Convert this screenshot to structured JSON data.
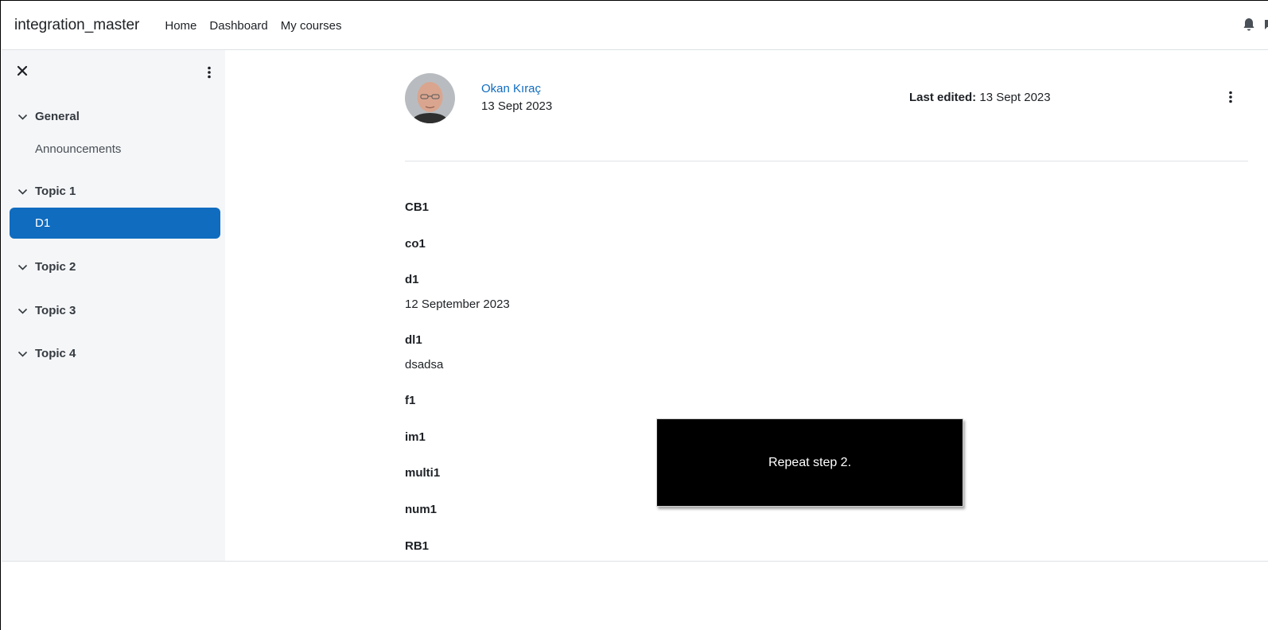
{
  "navbar": {
    "brand": "integration_master",
    "links": [
      "Home",
      "Dashboard",
      "My courses"
    ]
  },
  "drawer": {
    "sections": [
      {
        "title": "General",
        "items": [
          "Announcements"
        ]
      },
      {
        "title": "Topic 1",
        "items": [
          "D1"
        ],
        "active_item": "D1"
      },
      {
        "title": "Topic 2",
        "items": []
      },
      {
        "title": "Topic 3",
        "items": []
      },
      {
        "title": "Topic 4",
        "items": []
      }
    ]
  },
  "entry": {
    "author_name": "Okan Kıraç",
    "author_date": "13 Sept 2023",
    "last_edited_label": "Last edited:",
    "last_edited_value": "13 Sept 2023",
    "fields": [
      {
        "label": "CB1",
        "value": ""
      },
      {
        "label": "co1",
        "value": ""
      },
      {
        "label": "d1",
        "value": "12 September 2023"
      },
      {
        "label": "dl1",
        "value": "dsadsa"
      },
      {
        "label": "f1",
        "value": ""
      },
      {
        "label": "im1",
        "value": ""
      },
      {
        "label": "multi1",
        "value": ""
      },
      {
        "label": "num1",
        "value": ""
      },
      {
        "label": "RB1",
        "value": ""
      }
    ]
  },
  "overlay": {
    "text": "Repeat step 2."
  },
  "colors": {
    "accent": "#0f6cbf",
    "drawer_bg": "#f5f6f8",
    "overlay_bg": "#000000"
  },
  "icons": [
    "close-icon",
    "kebab-menu-icon",
    "chevron-down-icon",
    "bell-icon",
    "chat-icon"
  ]
}
